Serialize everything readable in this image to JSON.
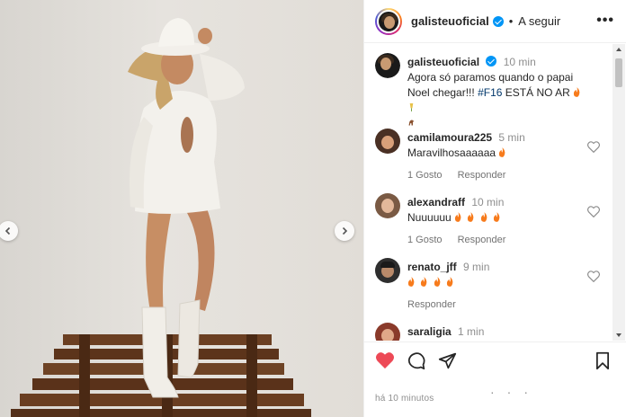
{
  "post": {
    "username": "galisteuoficial",
    "follow_label": "A seguir",
    "separator": "•",
    "more_label": "•••",
    "caption_time": "10 min",
    "caption_text": "Agora só paramos quando o papai Noel chegar!!!",
    "caption_hashtag": "#F16",
    "caption_tail": "ESTÁ NO AR",
    "posted_ago": "há 10 minutos",
    "liked": true
  },
  "comments": [
    {
      "username": "camilamoura225",
      "time": "5 min",
      "text": "Maravilhosaaaaaa",
      "fires": 1,
      "likes_label": "1 Gosto",
      "reply_label": "Responder"
    },
    {
      "username": "alexandraff",
      "time": "10 min",
      "text": "Nuuuuuu",
      "fires": 4,
      "likes_label": "1 Gosto",
      "reply_label": "Responder"
    },
    {
      "username": "renato_jff",
      "time": "9 min",
      "text": "",
      "fires": 4,
      "likes_label": "",
      "reply_label": "Responder"
    },
    {
      "username": "saraligia",
      "time": "1 min",
      "text": "",
      "fires": 0,
      "likes_label": "",
      "reply_label": ""
    }
  ],
  "colors": {
    "like_red": "#ed4956",
    "verified_blue": "#0095f6",
    "hashtag": "#00376b"
  },
  "icons": [
    "chevron-left-icon",
    "chevron-right-icon",
    "verified-icon",
    "heart-icon",
    "comment-icon",
    "share-icon",
    "bookmark-icon",
    "fire-icon"
  ]
}
